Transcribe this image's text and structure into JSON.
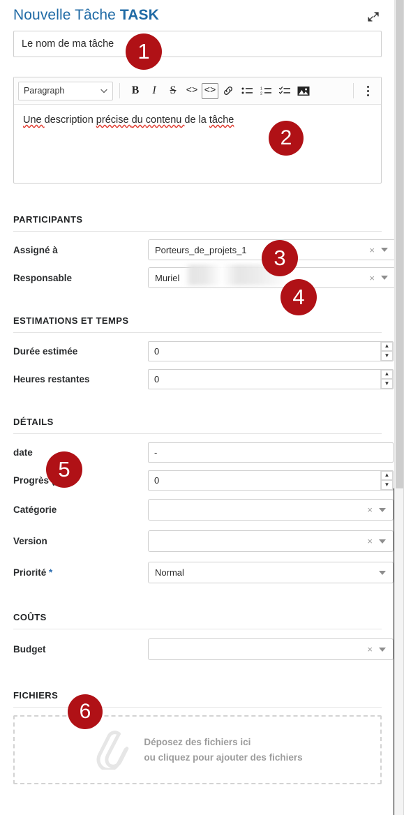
{
  "header": {
    "title_normal": "Nouvelle Tâche ",
    "title_strong": "TASK",
    "expand_icon": "expand-diagonal-icon"
  },
  "name_field": {
    "value": "Le nom de ma tâche",
    "placeholder": "Le nom de ma tâche"
  },
  "editor": {
    "style_select": {
      "value": "Paragraph",
      "caret_icon": "chevron-down-icon"
    },
    "buttons": [
      {
        "name": "bold-button",
        "glyph": "B"
      },
      {
        "name": "italic-button",
        "glyph": "I"
      },
      {
        "name": "strikethrough-button",
        "glyph": "S"
      },
      {
        "name": "inline-code-button",
        "glyph": "<>"
      },
      {
        "name": "code-block-button",
        "glyph": "<>"
      },
      {
        "name": "link-button",
        "glyph": "link-icon"
      },
      {
        "name": "bullet-list-button",
        "glyph": "bullet-list-icon"
      },
      {
        "name": "numbered-list-button",
        "glyph": "numbered-list-icon"
      },
      {
        "name": "task-list-button",
        "glyph": "checklist-icon"
      },
      {
        "name": "image-button",
        "glyph": "image-icon"
      },
      {
        "name": "more-options-button",
        "glyph": "kebab-menu-icon"
      }
    ],
    "body_text": {
      "w1": "Une ",
      "w2": "description ",
      "w3": "précise ",
      "w4": "du ",
      "w5": "contenu ",
      "w6": "de la ",
      "w7": "tâche"
    }
  },
  "sections": {
    "participants": {
      "title": "PARTICIPANTS",
      "rows": [
        {
          "label": "Assigné à",
          "value": "Porteurs_de_projets_1",
          "clear": "×",
          "caret": "chevron-down-icon"
        },
        {
          "label": "Responsable",
          "value": "Muriel",
          "clear": "×",
          "caret": "chevron-down-icon"
        }
      ]
    },
    "estimations": {
      "title": "ESTIMATIONS ET TEMPS",
      "rows": [
        {
          "label": "Durée estimée",
          "value": "0"
        },
        {
          "label": "Heures restantes",
          "value": "0"
        }
      ]
    },
    "details": {
      "title": "DÉTAILS",
      "date": {
        "label": "date",
        "value": "-"
      },
      "progress": {
        "label": "Progrès (%)",
        "value": "0"
      },
      "category": {
        "label": "Catégorie",
        "value": "",
        "clear": "×",
        "caret": "chevron-down-icon"
      },
      "version": {
        "label": "Version",
        "value": "",
        "clear": "×",
        "caret": "chevron-down-icon"
      },
      "priority": {
        "label": "Priorité ",
        "required_mark": "*",
        "value": "Normal",
        "caret": "chevron-down-icon"
      }
    },
    "couts": {
      "title": "COÛTS",
      "budget": {
        "label": "Budget",
        "value": "",
        "clear": "×",
        "caret": "chevron-down-icon"
      }
    },
    "fichiers": {
      "title": "FICHIERS",
      "dropzone": {
        "icon": "paperclip-icon",
        "line1": "Déposez des fichiers ici",
        "line2": "ou cliquez pour ajouter des fichiers"
      }
    }
  },
  "annotations": {
    "b1": "1",
    "b2": "2",
    "b3": "3",
    "b4": "4",
    "b5": "5",
    "b6": "6",
    "color": "#b01116"
  },
  "colors": {
    "title_blue": "#1f6aa5",
    "required_blue": "#2b6cb0",
    "badge_red": "#b01116",
    "border_gray": "#cfcfcf"
  }
}
